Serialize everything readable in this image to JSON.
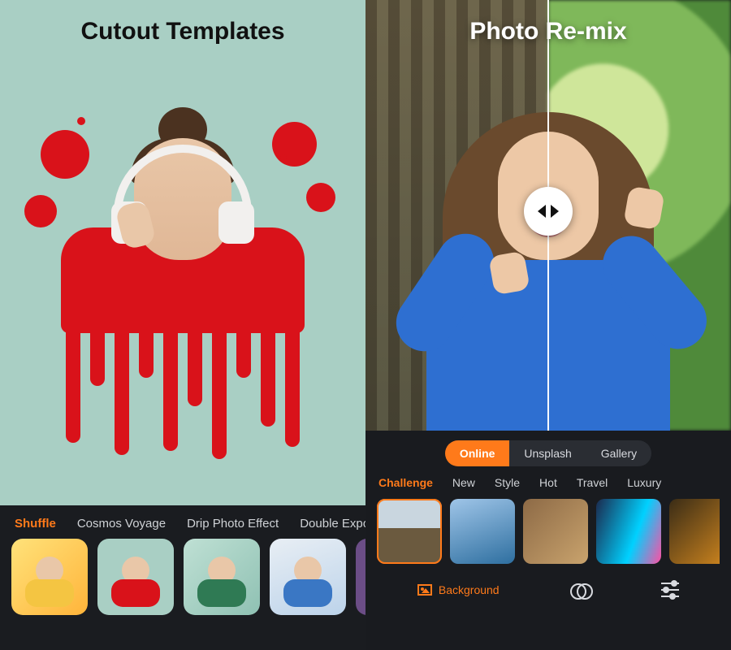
{
  "left": {
    "title": "Cutout Templates",
    "tabs": [
      "Shuffle",
      "Cosmos Voyage",
      "Drip Photo Effect",
      "Double Expos"
    ],
    "active_tab": "Shuffle"
  },
  "right": {
    "title": "Photo Re-mix",
    "sources": [
      "Online",
      "Unsplash",
      "Gallery"
    ],
    "active_source": "Online",
    "categories": [
      "Challenge",
      "New",
      "Style",
      "Hot",
      "Travel",
      "Luxury"
    ],
    "active_category": "Challenge",
    "tool_background_label": "Background"
  }
}
